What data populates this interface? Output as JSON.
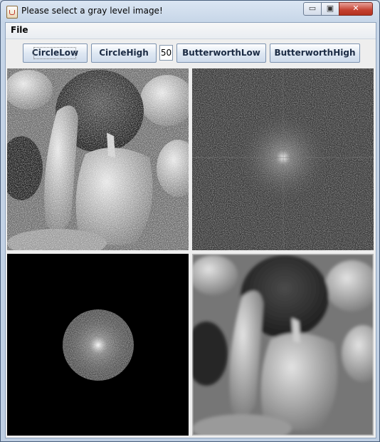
{
  "window": {
    "title": "Please select a gray level image!"
  },
  "titlebar_buttons": {
    "minimize": "▭",
    "maximize": "▣",
    "close": "✕"
  },
  "menu": {
    "file": "File"
  },
  "toolbar": {
    "circle_low": "CircleLow",
    "circle_high": "CircleHigh",
    "cutoff_value": "50",
    "butterworth_low": "ButterworthLow",
    "butterworth_high": "ButterworthHigh"
  },
  "panels": {
    "original": {
      "icon": "peppers-noisy-image"
    },
    "spectrum": {
      "icon": "fourier-spectrum-image"
    },
    "filtered_spectrum": {
      "icon": "circle-filtered-spectrum-image"
    },
    "result": {
      "icon": "peppers-lowpass-result-image"
    }
  }
}
